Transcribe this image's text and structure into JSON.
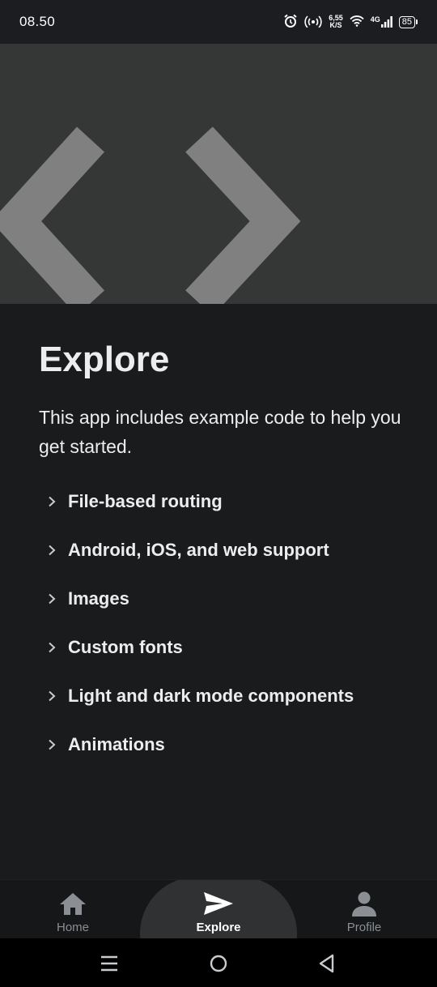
{
  "status_bar": {
    "time": "08.50",
    "network_speed_value": "6,55",
    "network_speed_unit": "K/S",
    "network_type": "4G",
    "battery": "85"
  },
  "header": {
    "icon": "code-brackets-icon",
    "background_color": "#353636",
    "icon_color": "#808080"
  },
  "main": {
    "title": "Explore",
    "intro": "This app includes example code to help you get started.",
    "items": [
      {
        "label": "File-based routing"
      },
      {
        "label": "Android, iOS, and web support"
      },
      {
        "label": "Images"
      },
      {
        "label": "Custom fonts"
      },
      {
        "label": "Light and dark mode components"
      },
      {
        "label": "Animations"
      }
    ]
  },
  "tabs": [
    {
      "label": "Home",
      "icon": "house-icon",
      "active": false
    },
    {
      "label": "Explore",
      "icon": "paper-plane-icon",
      "active": true
    },
    {
      "label": "Profile",
      "icon": "person-icon",
      "active": false
    }
  ],
  "nav_bar": {
    "buttons": [
      "menu-icon",
      "home-circle-icon",
      "back-triangle-icon"
    ]
  }
}
